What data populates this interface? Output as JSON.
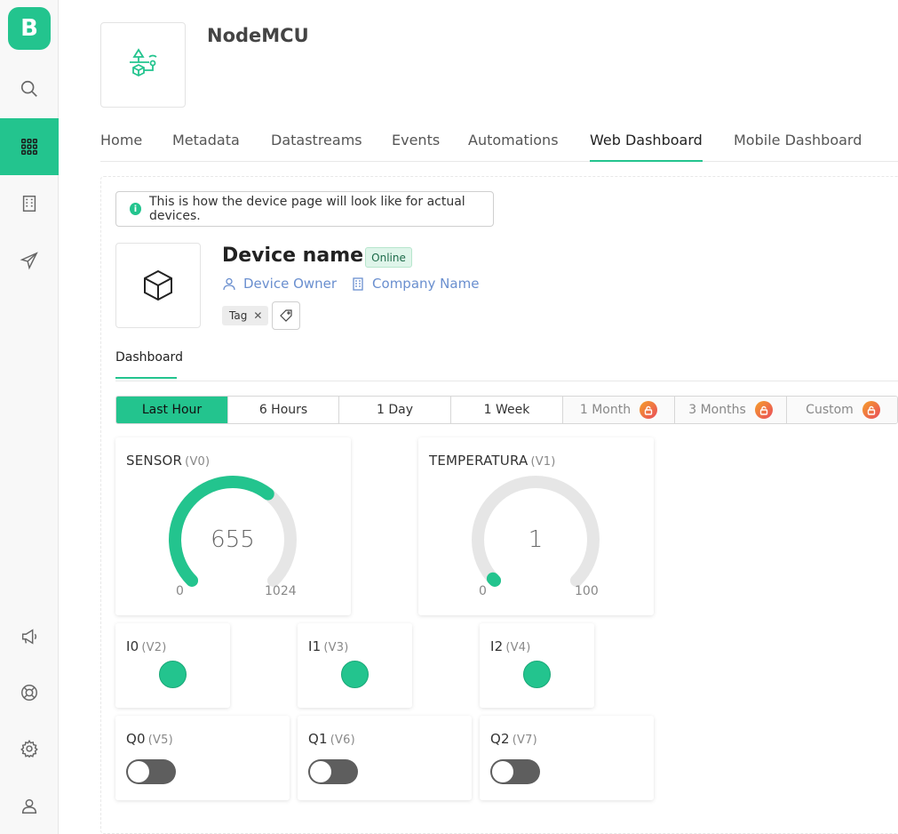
{
  "sidebar": {
    "logo_letter": "B",
    "items": [
      {
        "name": "search"
      },
      {
        "name": "devices"
      },
      {
        "name": "organizations"
      },
      {
        "name": "send"
      },
      {
        "name": "announcements"
      },
      {
        "name": "help"
      },
      {
        "name": "settings"
      },
      {
        "name": "user"
      }
    ]
  },
  "header": {
    "product_title": "NodeMCU",
    "tabs": [
      "Home",
      "Metadata",
      "Datastreams",
      "Events",
      "Automations",
      "Web Dashboard",
      "Mobile Dashboard"
    ],
    "active_tab": "Web Dashboard"
  },
  "info_banner": "This is how the device page will look like for actual devices.",
  "device": {
    "name": "Device name",
    "status": "Online",
    "owner": "Device Owner",
    "company": "Company Name",
    "tag": "Tag"
  },
  "subtab": "Dashboard",
  "time_ranges": [
    {
      "label": "Last Hour",
      "active": true,
      "locked": false
    },
    {
      "label": "6 Hours",
      "active": false,
      "locked": false
    },
    {
      "label": "1 Day",
      "active": false,
      "locked": false
    },
    {
      "label": "1 Week",
      "active": false,
      "locked": false
    },
    {
      "label": "1 Month",
      "active": false,
      "locked": true
    },
    {
      "label": "3 Months",
      "active": false,
      "locked": true
    },
    {
      "label": "Custom",
      "active": false,
      "locked": true
    }
  ],
  "gauges": [
    {
      "title": "SENSOR",
      "pin": "(V0)",
      "value": 655,
      "value_text": "655",
      "min": 0,
      "min_text": "0",
      "max": 1024,
      "max_text": "1024"
    },
    {
      "title": "TEMPERATURA",
      "pin": "(V1)",
      "value": 1,
      "value_text": "1",
      "min": 0,
      "min_text": "0",
      "max": 100,
      "max_text": "100"
    }
  ],
  "leds": [
    {
      "title": "I0",
      "pin": "(V2)",
      "on": true
    },
    {
      "title": "I1",
      "pin": "(V3)",
      "on": true
    },
    {
      "title": "I2",
      "pin": "(V4)",
      "on": true
    }
  ],
  "switches": [
    {
      "title": "Q0",
      "pin": "(V5)",
      "on": false
    },
    {
      "title": "Q1",
      "pin": "(V6)",
      "on": false
    },
    {
      "title": "Q2",
      "pin": "(V7)",
      "on": false
    }
  ],
  "colors": {
    "accent": "#23c48e",
    "gauge_track": "#e6e6e6",
    "link": "#6a8fcf",
    "switch_off": "#5e5e5e"
  }
}
